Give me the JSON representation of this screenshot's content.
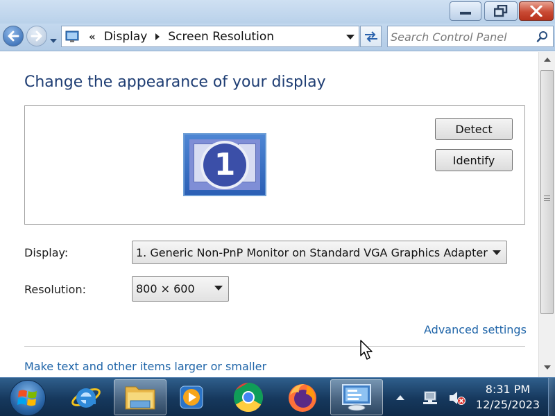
{
  "window": {
    "controls": {
      "minimize": "minimize-icon",
      "maximize": "restore-icon",
      "close": "close-icon"
    }
  },
  "address_bar": {
    "breadcrumb_overflow": "«",
    "breadcrumbs": [
      "Display",
      "Screen Resolution"
    ],
    "search_placeholder": "Search Control Panel"
  },
  "main": {
    "title": "Change the appearance of your display",
    "monitor_number": "1",
    "detect_label": "Detect",
    "identify_label": "Identify",
    "display_label": "Display:",
    "display_value": "1. Generic Non-PnP Monitor on Standard VGA Graphics Adapter",
    "resolution_label": "Resolution:",
    "resolution_value": "800 × 600",
    "advanced_link": "Advanced settings",
    "text_size_link": "Make text and other items larger or smaller"
  },
  "taskbar": {
    "apps": [
      "Internet Explorer",
      "Windows Explorer",
      "Windows Media Player",
      "Google Chrome",
      "Firefox",
      "Control Panel"
    ],
    "active_app": "Control Panel",
    "clock_time": "8:31 PM",
    "clock_date": "12/25/2023"
  },
  "colors": {
    "title_text": "#1e3d73",
    "link": "#1e64a8",
    "close_button": "#c94a34",
    "taskbar": "#16385d"
  }
}
